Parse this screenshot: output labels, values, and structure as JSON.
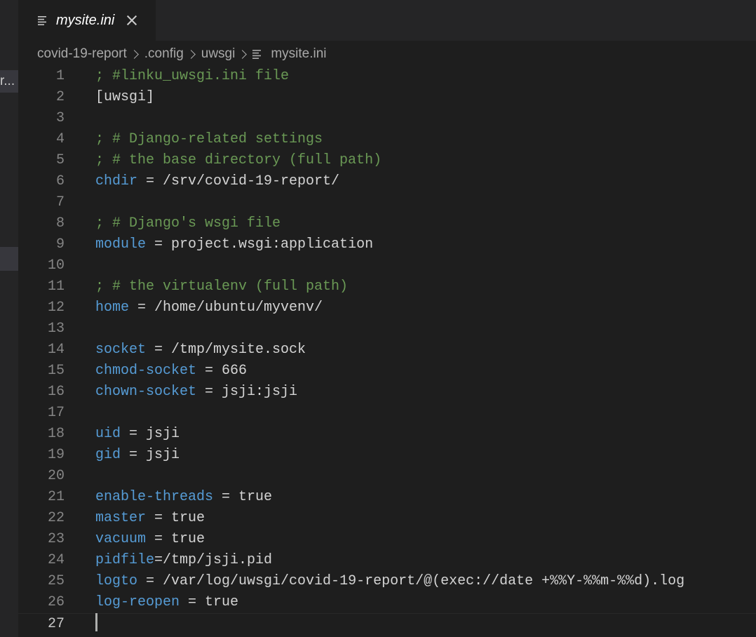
{
  "sidebar": {
    "truncated_label": "r..."
  },
  "tab": {
    "label": "mysite.ini",
    "icon": "file-lines-icon",
    "close_icon": "close-icon"
  },
  "breadcrumb": {
    "items": [
      "covid-19-report",
      ".config",
      "uwsgi",
      "mysite.ini"
    ]
  },
  "editor": {
    "current_line": 27,
    "lines": [
      {
        "n": "1",
        "comment": "; #linku_uwsgi.ini file"
      },
      {
        "n": "2",
        "plain": "[uwsgi]"
      },
      {
        "n": "3"
      },
      {
        "n": "4",
        "comment": "; # Django-related settings"
      },
      {
        "n": "5",
        "comment": "; # the base directory (full path)"
      },
      {
        "n": "6",
        "key": "chdir",
        "value": " = /srv/covid-19-report/"
      },
      {
        "n": "7"
      },
      {
        "n": "8",
        "comment": "; # Django's wsgi file"
      },
      {
        "n": "9",
        "key": "module",
        "value": " = project.wsgi:application"
      },
      {
        "n": "10"
      },
      {
        "n": "11",
        "comment": "; # the virtualenv (full path)"
      },
      {
        "n": "12",
        "key": "home",
        "value": " = /home/ubuntu/myvenv/"
      },
      {
        "n": "13"
      },
      {
        "n": "14",
        "key": "socket",
        "value": " = /tmp/mysite.sock"
      },
      {
        "n": "15",
        "key": "chmod-socket",
        "value": " = 666"
      },
      {
        "n": "16",
        "key": "chown-socket",
        "value": " = jsji:jsji"
      },
      {
        "n": "17"
      },
      {
        "n": "18",
        "key": "uid",
        "value": " = jsji"
      },
      {
        "n": "19",
        "key": "gid",
        "value": " = jsji"
      },
      {
        "n": "20"
      },
      {
        "n": "21",
        "key": "enable-threads",
        "value": " = true"
      },
      {
        "n": "22",
        "key": "master",
        "value": " = true"
      },
      {
        "n": "23",
        "key": "vacuum",
        "value": " = true"
      },
      {
        "n": "24",
        "key": "pidfile",
        "value": "=/tmp/jsji.pid"
      },
      {
        "n": "25",
        "key": "logto",
        "value": " = /var/log/uwsgi/covid-19-report/@(exec://date +%%Y-%%m-%%d).log"
      },
      {
        "n": "26",
        "key": "log-reopen",
        "value": " = true"
      },
      {
        "n": "27"
      }
    ]
  },
  "colors": {
    "background": "#1e1e1e",
    "comment": "#6a9955",
    "key": "#569cd6",
    "text": "#d4d4d4",
    "line_number": "#858585"
  }
}
